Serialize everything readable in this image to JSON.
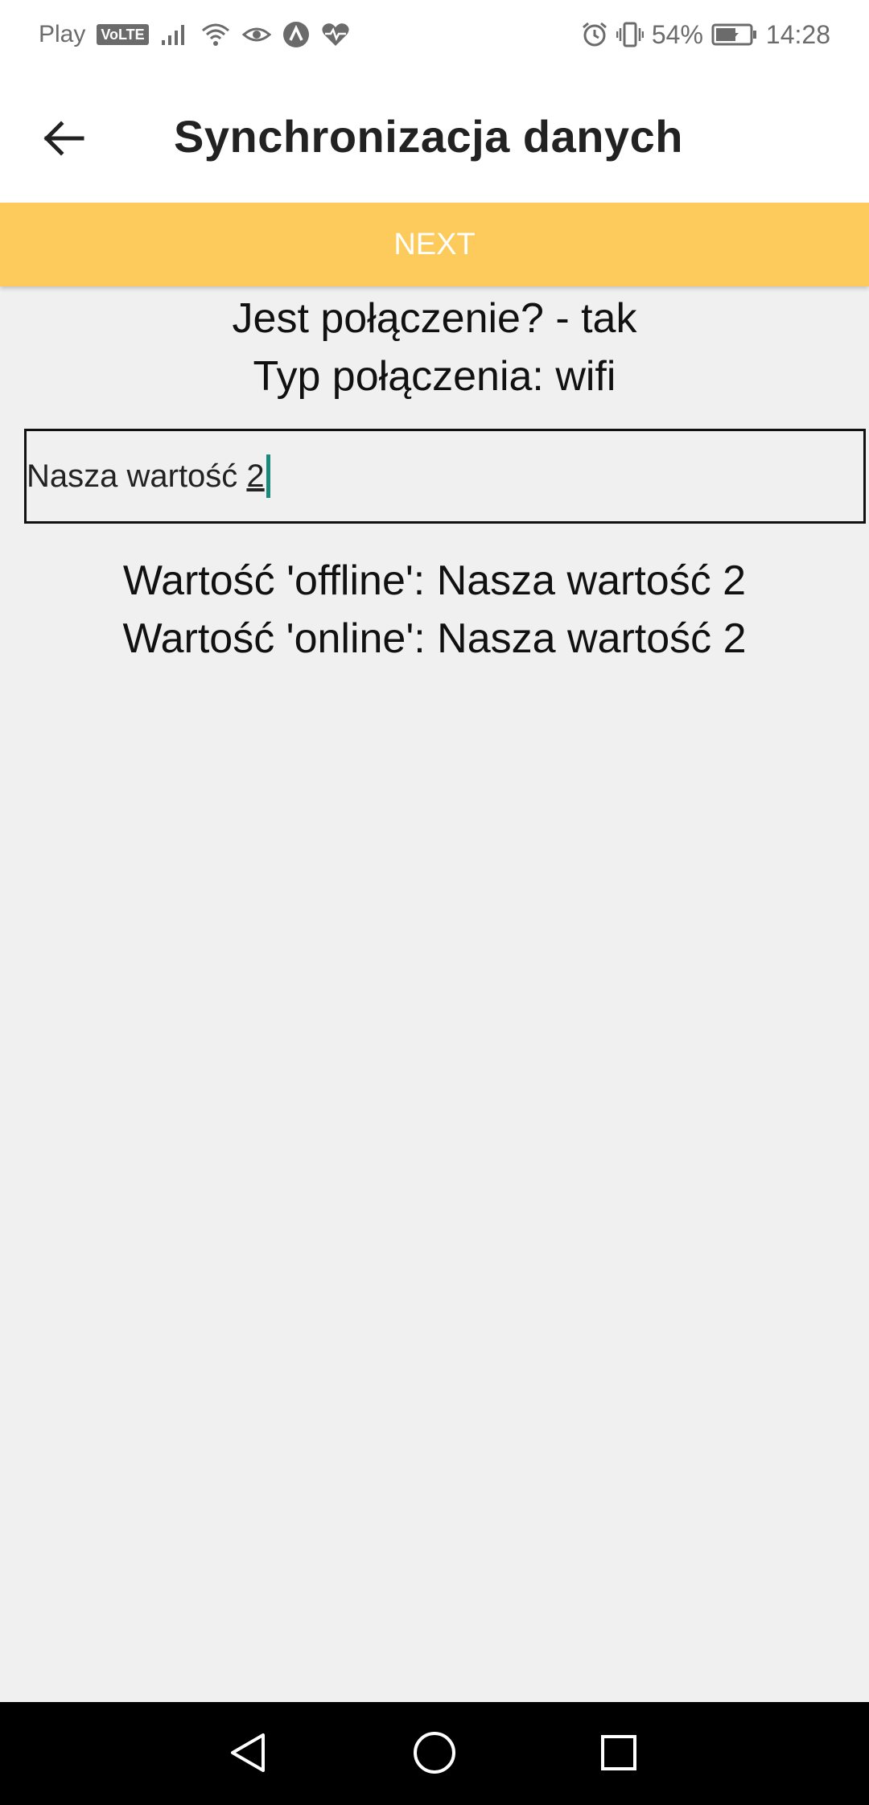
{
  "status_bar": {
    "carrier": "Play",
    "volte": "VoLTE",
    "battery": "54%",
    "time": "14:28"
  },
  "app_bar": {
    "title": "Synchronizacja danych"
  },
  "next_button": {
    "label": "NEXT"
  },
  "connection": {
    "is_connected": "Jest połączenie? - tak",
    "type": "Typ połączenia: wifi"
  },
  "input": {
    "value_prefix": "Nasza wartość ",
    "value_last": "2"
  },
  "results": {
    "offline": "Wartość 'offline': Nasza wartość 2",
    "online": "Wartość 'online': Nasza wartość 2"
  },
  "colors": {
    "accent": "#fdcb5c",
    "caret": "#1a8a7a"
  }
}
